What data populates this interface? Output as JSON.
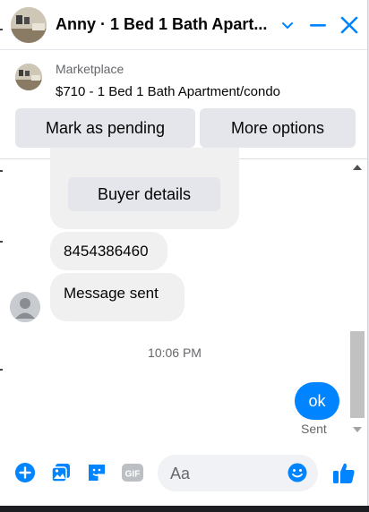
{
  "header": {
    "title": "Anny · 1 Bed 1 Bath Apart..."
  },
  "marketplace": {
    "label": "Marketplace",
    "listing": "$710 - 1 Bed 1 Bath Apartment/condo",
    "mark_pending_label": "Mark as pending",
    "more_options_label": "More options"
  },
  "chat": {
    "buyer_details_label": "Buyer details",
    "messages": [
      {
        "text": "8454386460"
      },
      {
        "text": "Message sent"
      }
    ],
    "timestamp": "10:06 PM",
    "my_message": "ok",
    "my_message_status": "Sent"
  },
  "composer": {
    "placeholder": "Aa",
    "gif_label": "GIF"
  },
  "colors": {
    "accent": "#0084ff",
    "bubble_gray": "#f0f0f0",
    "button_gray": "#e4e6eb"
  },
  "icons": [
    "chevron-down-icon",
    "minimize-icon",
    "close-icon",
    "plus-circle-icon",
    "photo-icon",
    "sticker-icon",
    "gif-icon",
    "emoji-icon",
    "like-icon"
  ]
}
